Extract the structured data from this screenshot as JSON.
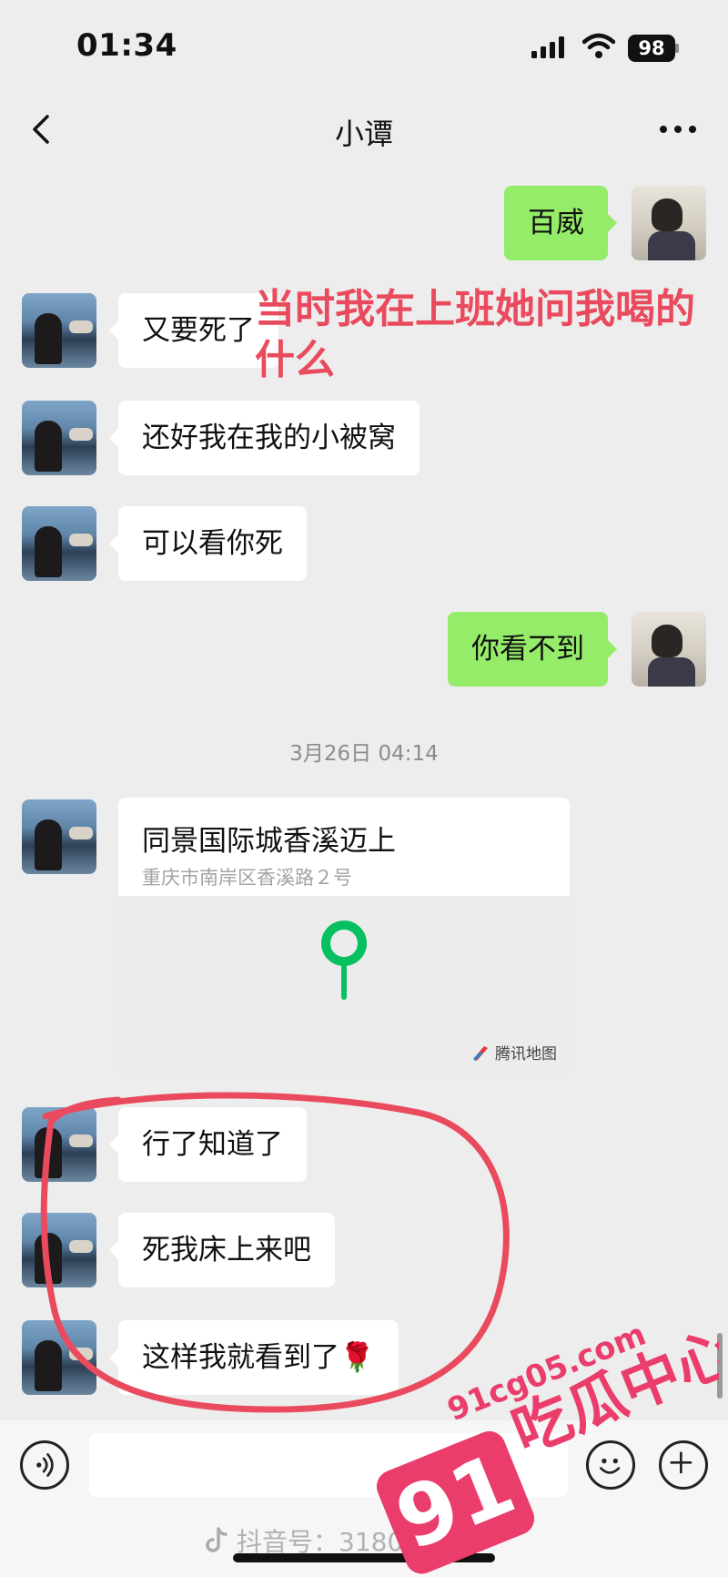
{
  "status_bar": {
    "time": "01:34",
    "battery": "98"
  },
  "nav": {
    "title": "小谭"
  },
  "messages": [
    {
      "text": "百威"
    },
    {
      "text": "又要死了"
    },
    {
      "text": "还好我在我的小被窝"
    },
    {
      "text": "可以看你死"
    },
    {
      "text": "你看不到"
    },
    {
      "text": "行了知道了"
    },
    {
      "text": "死我床上来吧"
    },
    {
      "text": "这样我就看到了🌹"
    }
  ],
  "timestamp": "3月26日 04:14",
  "location": {
    "name": "同景国际城香溪迈上",
    "address": "重庆市南岸区香溪路２号",
    "map_brand": "腾讯地图"
  },
  "overlay_caption": "当时我在上班她问我喝的什么",
  "tiktok_watermark": "抖音号：3180...8787",
  "site_watermark": {
    "number": "91",
    "domain": "91cg05.com",
    "name": "吃瓜中心"
  },
  "colors": {
    "background": "#ededed",
    "incoming_bubble": "#ffffff",
    "outgoing_bubble": "#95ec69",
    "annotation": "#ea4a5d",
    "pin": "#07c160"
  },
  "icons": [
    "back-icon",
    "more-icon",
    "voice-icon",
    "emoji-icon",
    "plus-icon",
    "location-pin-icon",
    "tiktok-icon"
  ]
}
